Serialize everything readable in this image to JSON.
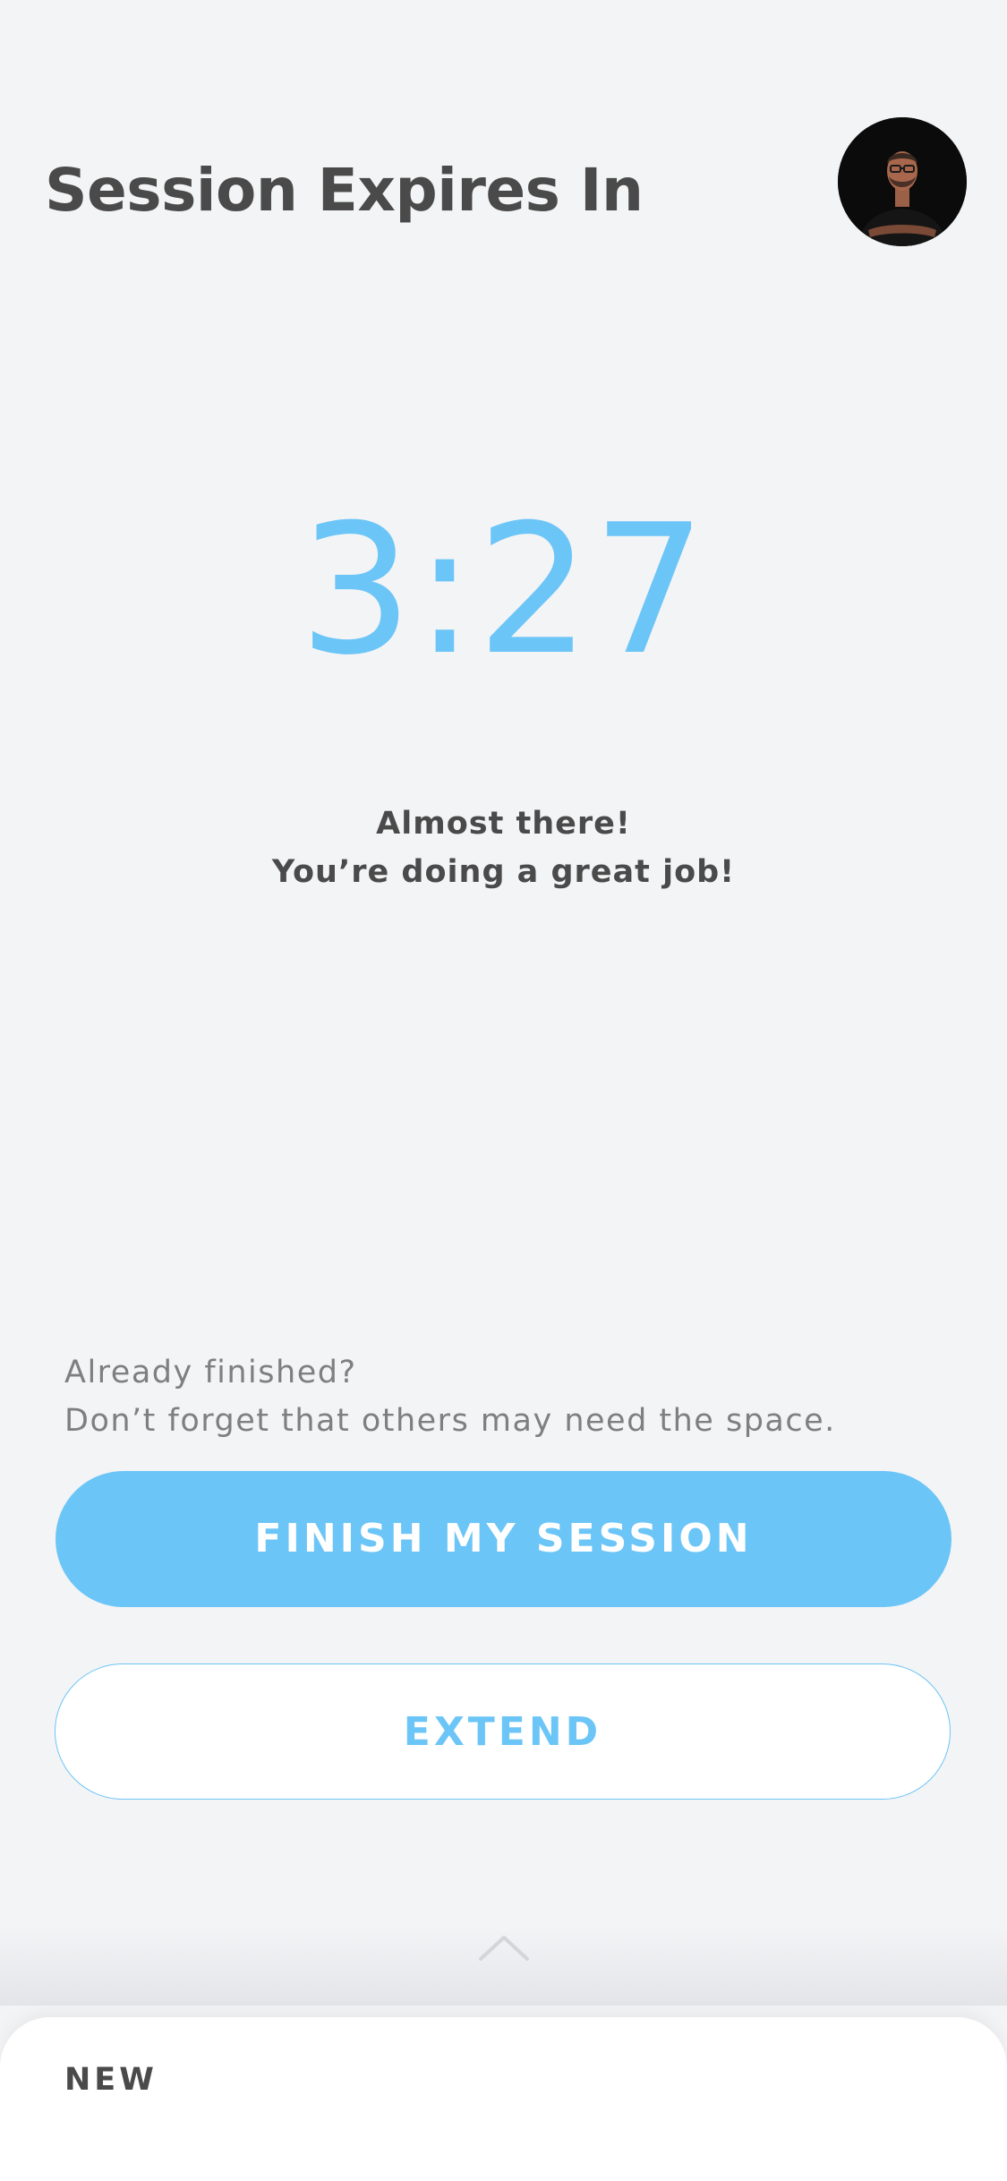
{
  "header": {
    "title": "Session Expires In",
    "avatar_label": "User profile photo"
  },
  "timer": {
    "value": "3:27"
  },
  "encouragement": {
    "line1": "Almost there!",
    "line2": "You’re doing a great job!"
  },
  "finish_hint": {
    "line1": "Already finished?",
    "line2": "Don’t forget that others may need the space."
  },
  "actions": {
    "finish_label": "FINISH MY SESSION",
    "extend_label": "EXTEND"
  },
  "bottom_sheet": {
    "handle_icon": "chevron-up-icon",
    "label": "NEW"
  },
  "colors": {
    "accent": "#6cc5f7",
    "text_dark": "#4a4a4a",
    "text_muted": "#7f7f7f",
    "background": "#f3f4f6"
  }
}
